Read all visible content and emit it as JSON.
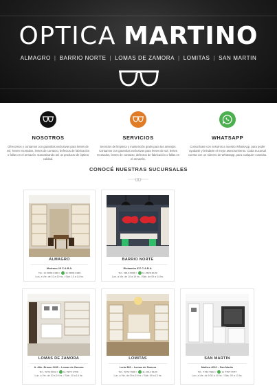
{
  "hero": {
    "title_light": "OPTICA",
    "title_bold": "MARTINO",
    "nav": [
      "ALMAGRO",
      "BARRIO NORTE",
      "LOMAS DE ZAMORA",
      "LOMITAS",
      "SAN MARTIN"
    ],
    "separator": "|"
  },
  "features": [
    {
      "icon": "glasses-icon",
      "color": "#111111",
      "title": "NOSOTROS",
      "text": "Ofrecemos y contamos con garantías exclusivas para lentes de sol, lentes recetados, lentes de contacto, defectos de fabricación o fallas en el armazón. Garantizando así un producto de óptima calidad."
    },
    {
      "icon": "glasses-icon",
      "color": "#e07b26",
      "title": "SERVICIOS",
      "text": "Servicios de limpieza y mantención gratis para tus anteojos. Contamos con garantías exclusivas para lentes de sol, lentes recetados, lentes de contacto, defectos de fabricación o fallas en el armazón."
    },
    {
      "icon": "whatsapp-icon",
      "color": "#4caf50",
      "title": "WHATSAPP",
      "text": "Comunícate con nosotros a nuestro WhatsApp, para poder ayudarte y brindarte el mejor asesoramiento. Cada Sucursal cuenta con un número de Whatsapp, para cualquier consulta."
    }
  ],
  "section": {
    "title": "CONOCÉ NUESTRAS SUCURSALES"
  },
  "branches": [
    {
      "name": "ALMAGRO",
      "address": "Medrano 29 C.A.B.A.",
      "phone": "Tel.: 11 2608-3186",
      "whatsapp": "11 2608-3186",
      "hours": "Lun. a Vie. de 10 a 19 hs. / Sáb. 10 a 14 hs."
    },
    {
      "name": "BARRIO NORTE",
      "address": "Riobamba 917 C.A.B.A.",
      "phone": "Tel.: 4813-0986",
      "whatsapp": "11 2526-8142",
      "hours": "Lun. a Vie. de 10 a 19 hs. / Sáb. de 09 a 14 hs."
    },
    {
      "name": "LOMAS DE ZAMORA",
      "address": "A. Alte. Brown 2439 – Lomas de Zamora",
      "phone": "Tel.: 4243-5023",
      "whatsapp": "11 4870-2405",
      "hours": "Lun. a Vie. de 10 a 19 hs. / Sáb. 10 a 14 hs."
    },
    {
      "name": "LOMITAS",
      "address": "Loria 389 – Lomas de Zamora",
      "phone": "Tel.: 4243-7536",
      "whatsapp": "11 2011-6150",
      "hours": "Lun. a Vie. de 09 a 19 hs. / Sáb. 09 a 13 hs."
    },
    {
      "name": "SAN MARTIN",
      "address": "Matheu 4020 – San Martin",
      "phone": "Tel.: 4752-4832",
      "whatsapp": "11 4404-9044",
      "hours": "Lun. a Vie. de 9:30 a 19 hs. / Sáb. 09 a 13 hs."
    }
  ]
}
